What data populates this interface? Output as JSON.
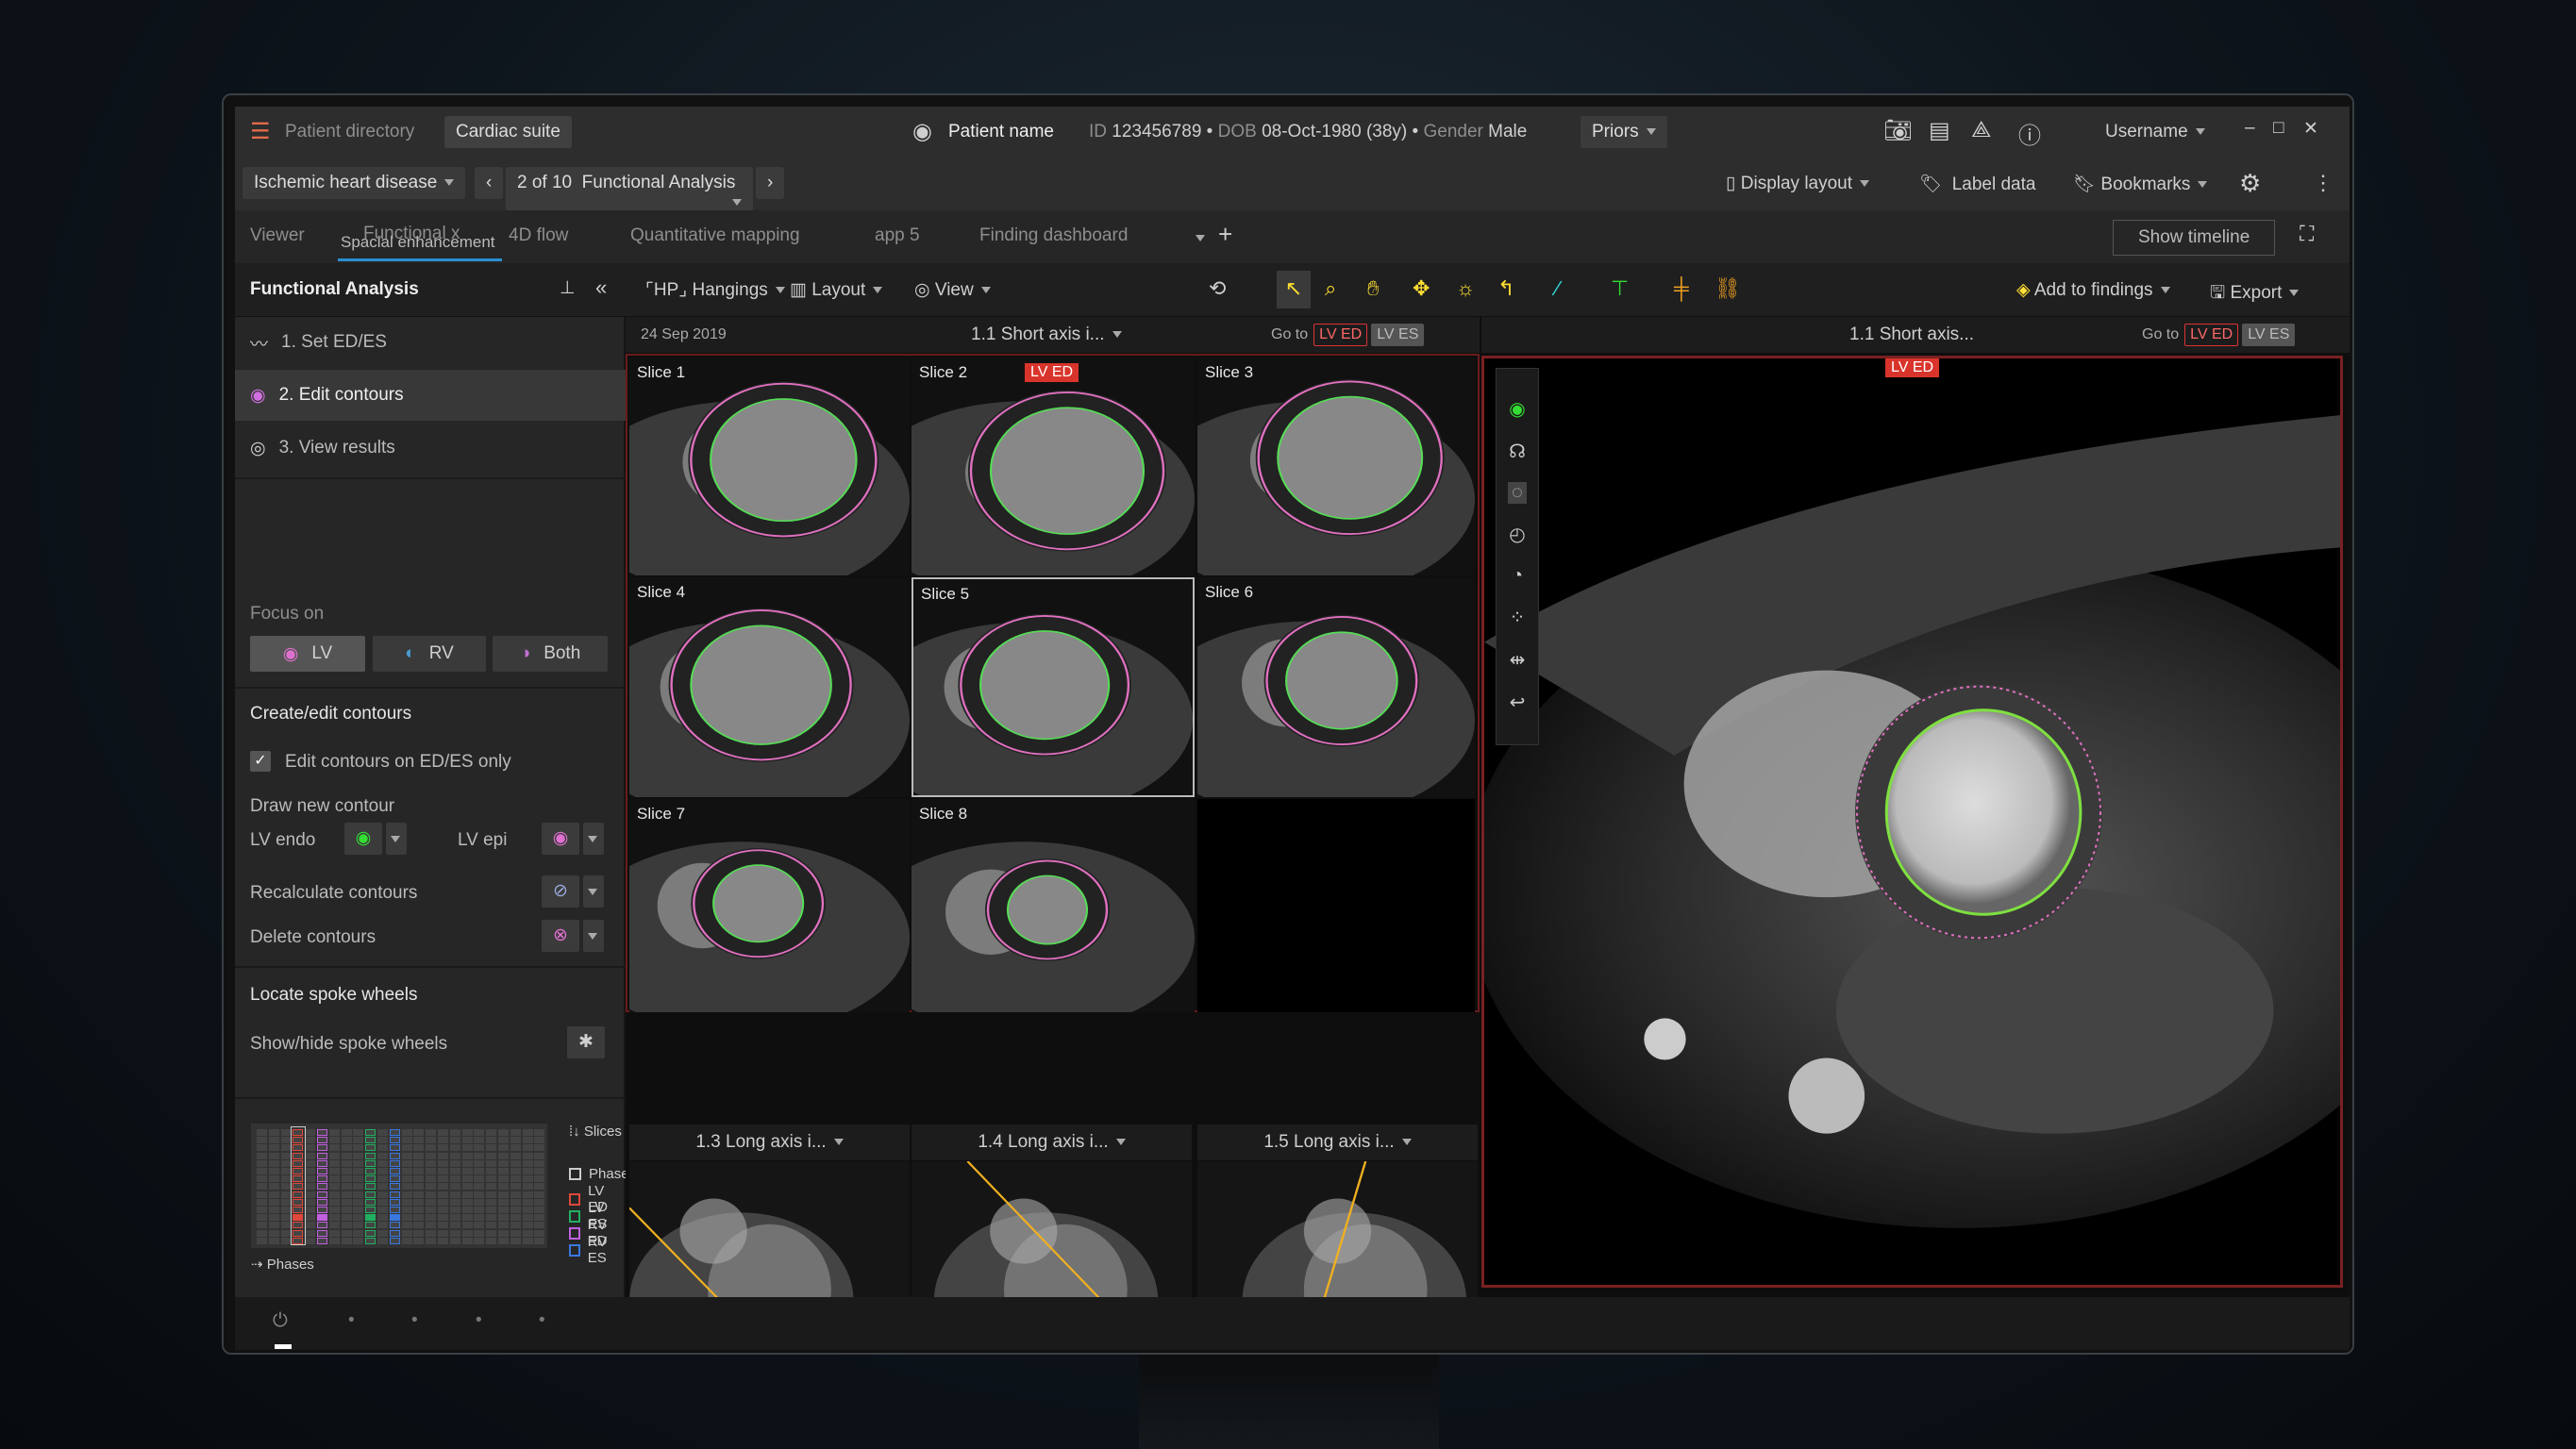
{
  "header": {
    "patient_directory": "Patient directory",
    "suite": "Cardiac suite",
    "patient_name": "Patient name",
    "id_label": "ID",
    "id": "123456789",
    "dob_label": "DOB",
    "dob": "08-Oct-1980 (38y)",
    "gender_label": "Gender",
    "gender": "Male",
    "priors": "Priors",
    "username": "Username"
  },
  "nav": {
    "protocol": "Ischemic heart disease",
    "position": "2 of 10",
    "step": "Functional Analysis",
    "display_layout": "Display layout",
    "label_data": "Label data",
    "bookmarks": "Bookmarks"
  },
  "tabs": {
    "items": [
      "Viewer",
      "Functional",
      "4D flow",
      "Quantitative mapping",
      "app 5",
      "Finding dashboard"
    ],
    "overlay": "Spacial enhancement",
    "close": "x",
    "show_timeline": "Show timeline"
  },
  "toolbar": {
    "hangings": "Hangings",
    "layout": "Layout",
    "view": "View",
    "add_findings": "Add to findings",
    "export": "Export"
  },
  "panel": {
    "title": "Functional Analysis",
    "steps": [
      "1. Set ED/ES",
      "2. Edit contours",
      "3. View results"
    ],
    "focus_label": "Focus on",
    "focus": [
      "LV",
      "RV",
      "Both"
    ],
    "create_title": "Create/edit contours",
    "edit_only": "Edit contours on ED/ES only",
    "edit_only_checked": true,
    "draw_new": "Draw new contour",
    "lv_endo": "LV endo",
    "lv_epi": "LV epi",
    "recalc": "Recalculate contours",
    "delete": "Delete contours",
    "spoke_title": "Locate spoke wheels",
    "spoke_toggle": "Show/hide spoke wheels",
    "slices": "Slices",
    "phases": "Phases",
    "legend": [
      {
        "label": "Phase",
        "color": "#cccccc"
      },
      {
        "label": "LV ED",
        "color": "#e0483b"
      },
      {
        "label": "LV ES",
        "color": "#22b060"
      },
      {
        "label": "RV ED",
        "color": "#c060e0"
      },
      {
        "label": "RV ES",
        "color": "#3a78e0"
      }
    ]
  },
  "viewer": {
    "date": "24 Sep 2019",
    "series": "1.1 Short axis i...",
    "goto": "Go to",
    "lv_ed": "LV ED",
    "lv_es": "LV ES",
    "slices": [
      "Slice 1",
      "Slice 2",
      "Slice 3",
      "Slice 4",
      "Slice 5",
      "Slice 6",
      "Slice 7",
      "Slice 8"
    ],
    "ed_badge": "LV ED",
    "long_axis": [
      "1.3 Long axis i...",
      "1.4 Long axis i...",
      "1.5 Long axis i..."
    ],
    "right_series": "1.1 Short axis...",
    "right_badge": "LV ED"
  }
}
